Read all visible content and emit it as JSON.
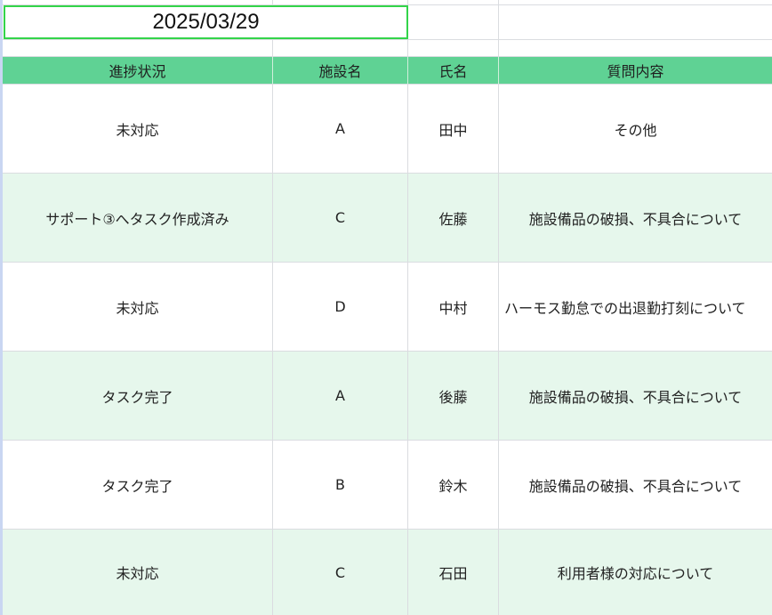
{
  "date": "2025/03/29",
  "headers": {
    "status": "進捗状況",
    "facility": "施設名",
    "name": "氏名",
    "question": "質問内容"
  },
  "rows": [
    {
      "status": "未対応",
      "facility": "A",
      "name": "田中",
      "question": "その他"
    },
    {
      "status": "サポート③へタスク作成済み",
      "facility": "C",
      "name": "佐藤",
      "question": "施設備品の破損、不具合について"
    },
    {
      "status": "未対応",
      "facility": "D",
      "name": "中村",
      "question": "ハーモス勤怠での出退勤打刻について"
    },
    {
      "status": "タスク完了",
      "facility": "A",
      "name": "後藤",
      "question": "施設備品の破損、不具合について"
    },
    {
      "status": "タスク完了",
      "facility": "B",
      "name": "鈴木",
      "question": "施設備品の破損、不具合について"
    },
    {
      "status": "未対応",
      "facility": "C",
      "name": "石田",
      "question": "利用者様の対応について"
    }
  ],
  "colors": {
    "header_bg": "#5fd294",
    "band_green": "#e6f7ec",
    "selection_border": "#33d44a",
    "grid": "#dadce0"
  }
}
